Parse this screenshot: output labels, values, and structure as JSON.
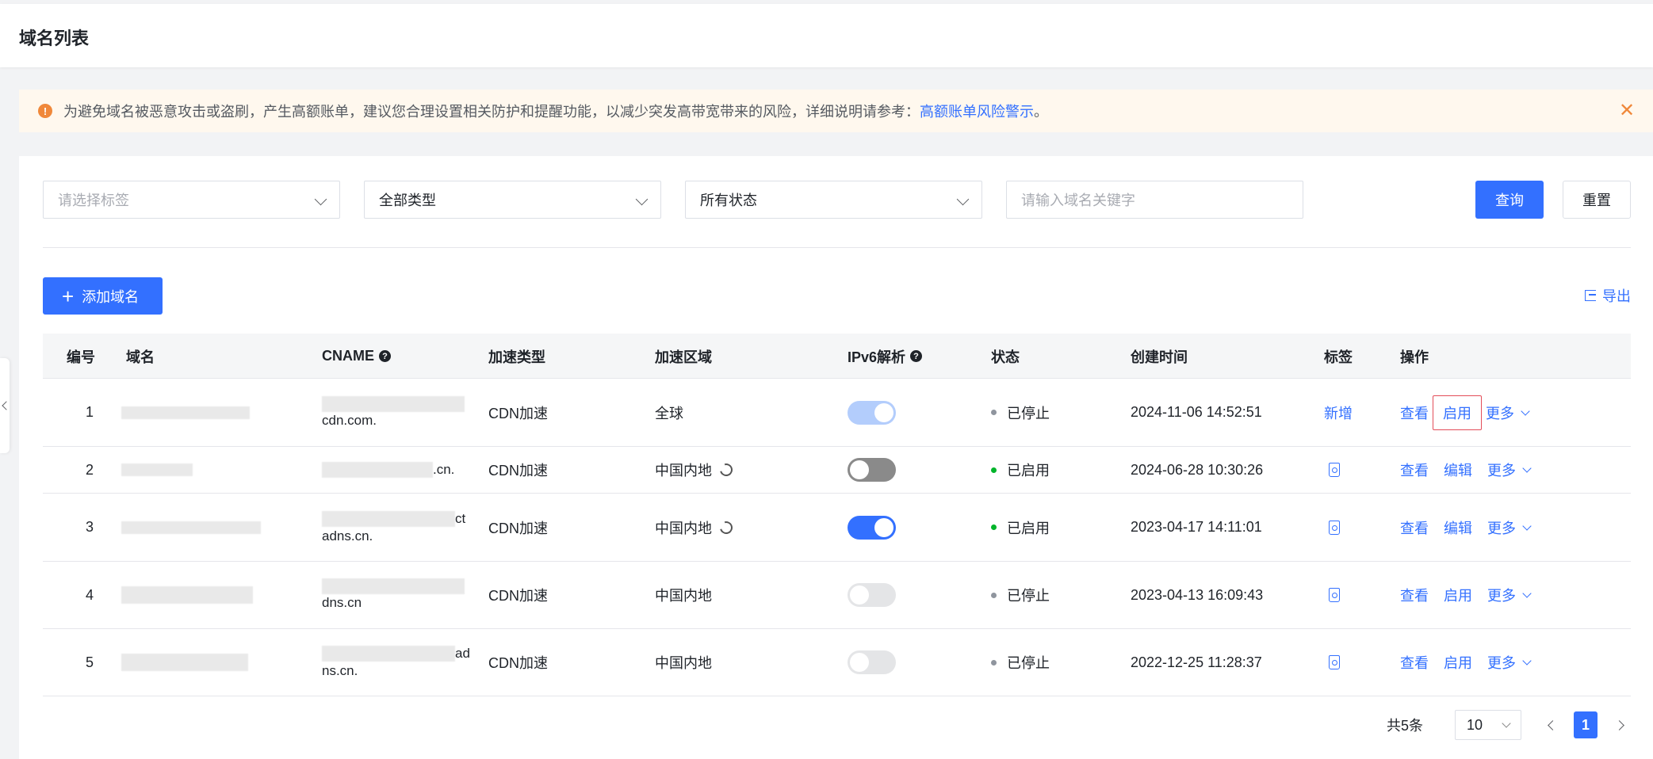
{
  "header": {
    "title": "域名列表"
  },
  "notice": {
    "text": "为避免域名被恶意攻击或盗刷，产生高额账单，建议您合理设置相关防护和提醒功能，以减少突发高带宽带来的风险，详细说明请参考：",
    "link_text": "高额账单风险警示",
    "suffix": "。",
    "icon_glyph": "!"
  },
  "filters": {
    "tag_placeholder": "请选择标签",
    "type_value": "全部类型",
    "status_value": "所有状态",
    "keyword_placeholder": "请输入域名关键字",
    "query_label": "查询",
    "reset_label": "重置"
  },
  "toolbar": {
    "add_label": "添加域名",
    "export_label": "导出"
  },
  "table": {
    "columns": [
      "编号",
      "域名",
      "CNAME",
      "加速类型",
      "加速区域",
      "IPv6解析",
      "状态",
      "创建时间",
      "标签",
      "操作"
    ],
    "rows": [
      {
        "id": "1",
        "cname_suffix": "cdn.com.",
        "type": "CDN加速",
        "region": "全球",
        "region_refresh": false,
        "ipv6": "on-disabled",
        "status": "已停止",
        "status_color": "#8f959e",
        "created": "2024-11-06 14:52:51",
        "tag": "新增",
        "ops": [
          "查看",
          "启用"
        ],
        "more": "更多",
        "highlight": true
      },
      {
        "id": "2",
        "cname_suffix": ".cn.",
        "type": "CDN加速",
        "region": "中国内地",
        "region_refresh": true,
        "ipv6": "off-dark",
        "status": "已启用",
        "status_color": "#00b42a",
        "created": "2024-06-28 10:30:26",
        "tag": "",
        "ops": [
          "查看",
          "编辑"
        ],
        "more": "更多",
        "highlight": false
      },
      {
        "id": "3",
        "cname_suffix": "ct",
        "cname_suffix2": "adns.cn.",
        "type": "CDN加速",
        "region": "中国内地",
        "region_refresh": true,
        "ipv6": "on",
        "status": "已启用",
        "status_color": "#00b42a",
        "created": "2023-04-17 14:11:01",
        "tag": "",
        "ops": [
          "查看",
          "编辑"
        ],
        "more": "更多",
        "highlight": false
      },
      {
        "id": "4",
        "cname_suffix": "dns.cn",
        "type": "CDN加速",
        "region": "中国内地",
        "region_refresh": false,
        "ipv6": "off-light",
        "status": "已停止",
        "status_color": "#8f959e",
        "created": "2023-04-13 16:09:43",
        "tag": "",
        "ops": [
          "查看",
          "启用"
        ],
        "more": "更多",
        "highlight": false
      },
      {
        "id": "5",
        "cname_suffix": "ad",
        "cname_suffix2": "ns.cn.",
        "type": "CDN加速",
        "region": "中国内地",
        "region_refresh": false,
        "ipv6": "off-light",
        "status": "已停止",
        "status_color": "#8f959e",
        "created": "2022-12-25 11:28:37",
        "tag": "",
        "ops": [
          "查看",
          "启用"
        ],
        "more": "更多",
        "highlight": false
      }
    ]
  },
  "pagination": {
    "total_text": "共5条",
    "page_size": "10",
    "current_page": "1"
  },
  "colors": {
    "primary": "#3370ff",
    "warning": "#f0883a",
    "danger_outline": "#e34d59"
  }
}
